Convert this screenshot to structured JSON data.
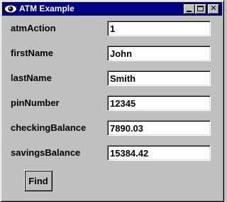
{
  "window": {
    "title": "ATM Example",
    "icon": "eye-icon",
    "controls": {
      "minimize": "minimize-icon",
      "maximize": "maximize-icon",
      "close_label": "✕"
    }
  },
  "form": {
    "fields": [
      {
        "label": "atmAction",
        "value": "1"
      },
      {
        "label": "firstName",
        "value": "John"
      },
      {
        "label": "lastName",
        "value": "Smith"
      },
      {
        "label": "pinNumber",
        "value": "12345"
      },
      {
        "label": "checkingBalance",
        "value": "7890.03"
      },
      {
        "label": "savingsBalance",
        "value": "15384.42"
      }
    ],
    "find_label": "Find"
  },
  "colors": {
    "titlebar": "#000080",
    "face": "#c0c0c0"
  }
}
